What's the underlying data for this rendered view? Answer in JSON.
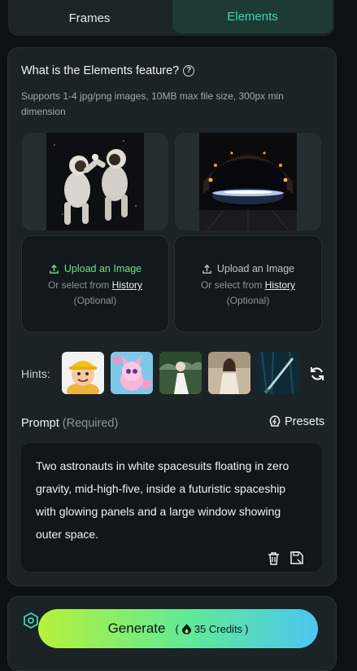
{
  "tabs": {
    "frames": "Frames",
    "elements": "Elements"
  },
  "elements_panel": {
    "title": "What is the Elements feature?",
    "subtitle": "Supports 1-4 jpg/png images, 10MB max file size, 300px min dimension"
  },
  "uploads": [
    {
      "label": "Upload an Image",
      "select_prefix": "Or select from",
      "history": "History",
      "optional": "(Optional)"
    },
    {
      "label": "Upload an Image",
      "select_prefix": "Or select from",
      "history": "History",
      "optional": "(Optional)"
    }
  ],
  "hints": {
    "label": "Hints:"
  },
  "prompt": {
    "label": "Prompt",
    "required": "(Required)",
    "presets": "Presets",
    "text": "Two astronauts in white spacesuits floating in zero gravity, mid-high-five, inside a futuristic spaceship with glowing panels and a large window showing outer space."
  },
  "generate": {
    "label": "Generate",
    "credits": "35 Credits"
  },
  "colors": {
    "accent": "#3ad6b6",
    "upload_green": "#6de08a"
  }
}
